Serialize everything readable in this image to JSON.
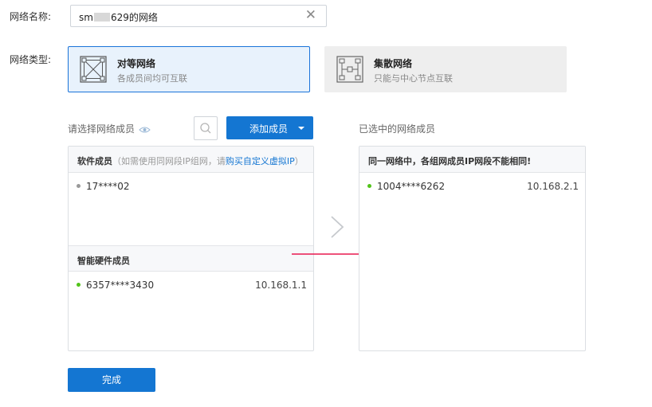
{
  "form": {
    "name_label": "网络名称:",
    "name_prefix": "sm",
    "name_suffix": "629的网络",
    "type_label": "网络类型:"
  },
  "network_types": [
    {
      "title": "对等网络",
      "subtitle": "各成员间均可互联",
      "selected": true
    },
    {
      "title": "集散网络",
      "subtitle": "只能与中心节点互联",
      "selected": false
    }
  ],
  "member_select": {
    "title": "请选择网络成员",
    "add_button": "添加成员"
  },
  "software_members": {
    "header": "软件成员",
    "hint": "（如需使用同网段IP组网，请",
    "link": "购买自定义虚拟IP",
    "hint_end": "）",
    "items": [
      {
        "id": "17****02",
        "ip": "",
        "status": "offline"
      }
    ]
  },
  "hardware_members": {
    "header": "智能硬件成员",
    "items": [
      {
        "id": "6357****3430",
        "ip": "10.168.1.1",
        "status": "online"
      }
    ]
  },
  "selected_members": {
    "title": "已选中的网络成员",
    "warning": "同一网络中，各组网成员IP网段不能相同!",
    "items": [
      {
        "id": "1004****6262",
        "ip": "10.168.2.1",
        "status": "online"
      }
    ]
  },
  "done_button": "完成",
  "colors": {
    "primary": "#1476d2",
    "online": "#52c41a",
    "offline": "#999999",
    "annotation_arrow": "#e8194f"
  }
}
